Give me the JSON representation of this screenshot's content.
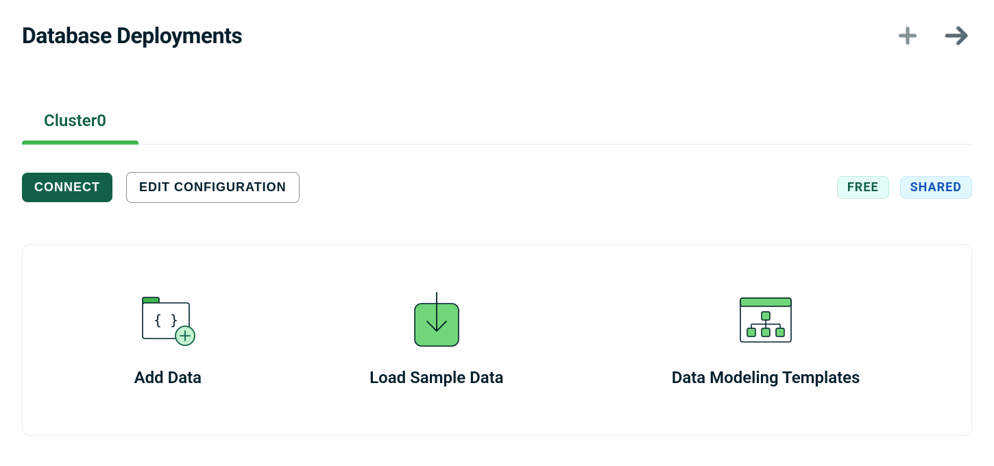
{
  "header": {
    "title": "Database Deployments"
  },
  "cluster": {
    "name": "Cluster0"
  },
  "actions": {
    "connect": "CONNECT",
    "edit": "EDIT CONFIGURATION"
  },
  "badges": {
    "free": "FREE",
    "shared": "SHARED"
  },
  "cards": {
    "add_data": "Add Data",
    "load_sample": "Load Sample Data",
    "templates": "Data Modeling Templates"
  }
}
